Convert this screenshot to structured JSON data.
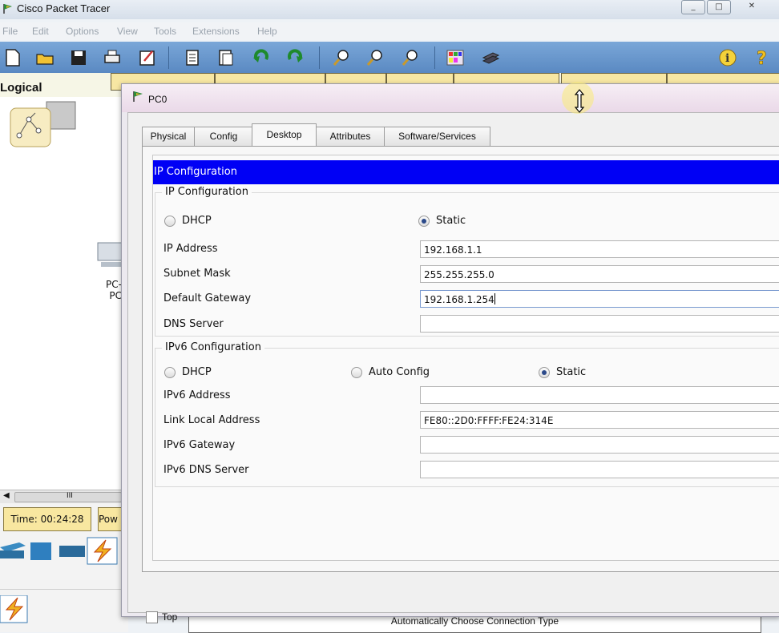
{
  "app": {
    "title": "Cisco Packet Tracer",
    "window_controls": [
      "_",
      "□",
      "✕"
    ]
  },
  "menu": [
    "File",
    "Edit",
    "Options",
    "View",
    "Tools",
    "Extensions",
    "Help"
  ],
  "toolbar_icons": [
    "new-icon",
    "open-icon",
    "save-icon",
    "print-icon",
    "activity-wizard-icon",
    "copy-icon",
    "paste-icon",
    "undo-icon",
    "redo-icon",
    "zoom-in-icon",
    "zoom-reset-icon",
    "zoom-out-icon",
    "palette-icon",
    "custom-device-icon",
    "info-icon",
    "help-icon"
  ],
  "workspace": {
    "mode_label": "Logical",
    "device_label_partial": "PC-\nPC",
    "time_label": "Time: 00:24:28",
    "power_partial": "Pow",
    "scroll_text": "III",
    "status_text": "Automatically Choose Connection Type"
  },
  "dialog": {
    "title": "PC0",
    "tabs": [
      "Physical",
      "Config",
      "Desktop",
      "Attributes",
      "Software/Services"
    ],
    "active_tab": "Desktop",
    "header": "IP Configuration",
    "ipv4": {
      "group_title": "IP Configuration",
      "dhcp_label": "DHCP",
      "static_label": "Static",
      "selected": "Static",
      "fields": [
        {
          "label": "IP Address",
          "value": "192.168.1.1"
        },
        {
          "label": "Subnet Mask",
          "value": "255.255.255.0"
        },
        {
          "label": "Default Gateway",
          "value": "192.168.1.254"
        },
        {
          "label": "DNS Server",
          "value": ""
        }
      ]
    },
    "ipv6": {
      "group_title": "IPv6 Configuration",
      "dhcp_label": "DHCP",
      "auto_label": "Auto Config",
      "static_label": "Static",
      "selected": "Static",
      "fields": [
        {
          "label": "IPv6 Address",
          "value": ""
        },
        {
          "label": "Link Local Address",
          "value": "FE80::2D0:FFFF:FE24:314E"
        },
        {
          "label": "IPv6 Gateway",
          "value": ""
        },
        {
          "label": "IPv6 DNS Server",
          "value": ""
        }
      ]
    },
    "top_checkbox_label": "Top",
    "top_checked": false
  }
}
